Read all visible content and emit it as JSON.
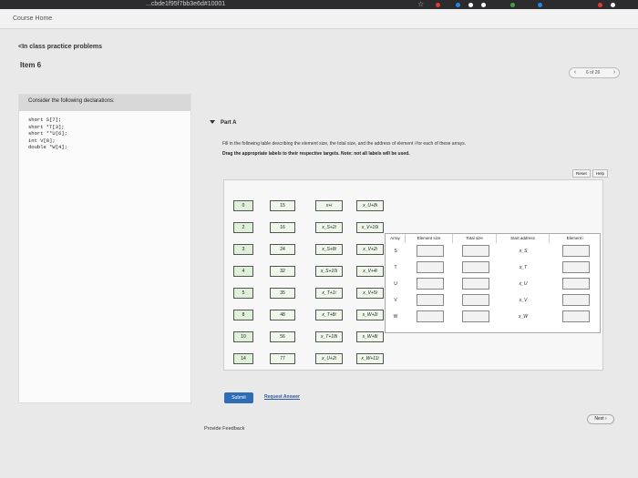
{
  "browser": {
    "url_fragment": "...cbde1f95f7bb3e6d#10001",
    "star": "☆"
  },
  "nav": {
    "home_label": "Course Home"
  },
  "breadcrumb": "<In class practice problems",
  "item_title": "Item 6",
  "pager": {
    "count": "6 of 26",
    "prev": "‹",
    "next": "›"
  },
  "left_panel": {
    "header": "Consider the following declarations:",
    "lines": [
      "short S[7];",
      "short *T[3];",
      "short **U[6];",
      "int V[8];",
      "double *W[4];"
    ]
  },
  "part": {
    "title": "Part A",
    "instruction": "Fill in the following table describing the element size, the total size, and the address of element i for each of these arrays.",
    "drag_note": "Drag the appropriate labels to their respective targets. Note: not all labels will be used.",
    "reset_label": "Reset",
    "help_label": "Help"
  },
  "tiles": {
    "col1": [
      "0",
      "2",
      "3",
      "4",
      "5",
      "8",
      "10",
      "14"
    ],
    "col2": [
      "15",
      "16",
      "24",
      "32",
      "35",
      "48",
      "56",
      "77"
    ],
    "col3": [
      "x+i",
      "x_S+2i",
      "x_S+8i",
      "x_S+10i",
      "x_T+1i",
      "x_T+8i",
      "x_T+18i",
      "x_U+2i"
    ],
    "col4": [
      "x_U+8i",
      "x_V+16i",
      "x_V+2i",
      "x_V+4i",
      "x_V+5i",
      "x_W+2i",
      "x_W+8i",
      "x_W+11i"
    ]
  },
  "table": {
    "headers": [
      "Array",
      "Element size",
      "Total size",
      "Start address",
      "Element i"
    ],
    "rows": [
      {
        "array": "S",
        "start": "x_S"
      },
      {
        "array": "T",
        "start": "x_T"
      },
      {
        "array": "U",
        "start": "x_U"
      },
      {
        "array": "V",
        "start": "x_V"
      },
      {
        "array": "W",
        "start": "x_W"
      }
    ]
  },
  "actions": {
    "submit_label": "Submit",
    "request_answer_label": "Request Answer",
    "next_label": "Next ›",
    "feedback_label": "Provide Feedback"
  },
  "colors": {
    "accent": "#2e6db4",
    "tile_bg": "#eef7ea"
  }
}
